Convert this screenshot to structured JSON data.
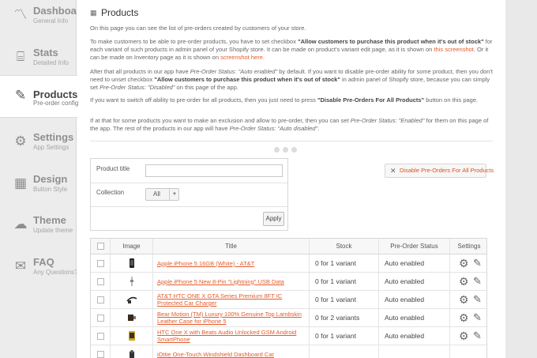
{
  "sidebar": {
    "items": [
      {
        "icon": "line-chart-icon",
        "glyph": "〽",
        "title": "Dashboard",
        "subtitle": "General Info"
      },
      {
        "icon": "presentation-icon",
        "glyph": "⌸",
        "title": "Stats",
        "subtitle": "Detailed Info"
      },
      {
        "icon": "edit-icon",
        "glyph": "✎",
        "title": "Products",
        "subtitle": "Pre-order config"
      },
      {
        "icon": "gears-icon",
        "glyph": "⚙",
        "title": "Settings",
        "subtitle": "App Settings"
      },
      {
        "icon": "layout-icon",
        "glyph": "▦",
        "title": "Design",
        "subtitle": "Button Style"
      },
      {
        "icon": "cloud-icon",
        "glyph": "☁",
        "title": "Theme",
        "subtitle": "Update theme"
      },
      {
        "icon": "chat-icon",
        "glyph": "✉",
        "title": "FAQ",
        "subtitle": "Any Questions?"
      }
    ]
  },
  "page": {
    "title": "Products",
    "intro": "On this page you can see the list of pre-orders created by customers of your store.",
    "p2_a": "To make customers to be able to pre-order products, you have to set checkbox ",
    "p2_b": "\"Allow customers to purchase this product when it's out of stock\"",
    "p2_c": " for each variant of such products in admin panel of your Shopify store. It can be made on product's variant edit page, as it is shown on ",
    "p2_link1": "this screenshot",
    "p2_d": ". Or it can be made on Inventory page as it is shown on ",
    "p2_link2": "screenshot here",
    "p2_e": ".",
    "p3_a": "After that all products in our app have ",
    "p3_b": "Pre-Order Status: \"Auto enabled\"",
    "p3_c": " by default. If you want to disable pre-order ability for some product, then you don't need to unset checkbox ",
    "p3_d": "\"Allow customers to purchase this product when it's out of stock\"",
    "p3_e": " in admin panel of Shopify store, because you can simply set ",
    "p3_f": "Pre-Order Status: \"Disabled\"",
    "p3_g": " on this page of the app.",
    "p4_a": "If you want to switch off ability to pre-order for all products, then you just need to press ",
    "p4_b": "\"Disable Pre-Orders For All Products\"",
    "p4_c": " button on this page.",
    "p5_a": "If at that for some products you want to make an exclusion and allow to pre-order, then you can set ",
    "p5_b": "Pre-Order Status: \"Enabled\"",
    "p5_c": " for them on this page of the app. The rest of the products in our app will have ",
    "p5_d": "Pre-Order Status: \"Auto disabled\"",
    "p5_e": "."
  },
  "filter": {
    "title_label": "Product title",
    "title_value": "",
    "collection_label": "Collection",
    "collection_value": "All",
    "apply_label": "Apply"
  },
  "disable_button": "Disable Pre-Orders For All Products",
  "table": {
    "headers": [
      "Image",
      "Title",
      "Stock",
      "Pre-Order Status",
      "Settings"
    ],
    "rows": [
      {
        "thumb": "phone-white",
        "title": "Apple iPhone 5 16GB (White) - AT&T",
        "stock": "0 for 1 variant",
        "status": "Auto enabled"
      },
      {
        "thumb": "cable",
        "title": "Apple iPhone 5 New 8-Pin \"Lightning\" USB Data",
        "stock": "0 for 1 variant",
        "status": "Auto enabled"
      },
      {
        "thumb": "charger",
        "title": "AT&T HTC ONE X GTA Series Premium 8FT IC Protected Car Charger",
        "stock": "0 for 1 variant",
        "status": "Auto enabled"
      },
      {
        "thumb": "case",
        "title": "Bear Motion (TM) Luxury 100% Genuine Top Lambskin Leather Case for iPhone 5",
        "stock": "0 for 2 variants",
        "status": "Auto enabled"
      },
      {
        "thumb": "case-yellow",
        "title": "HTC One X with Beats Audio Unlocked GSM Android SmartPhone",
        "stock": "0 for 1 variant",
        "status": "Auto enabled"
      },
      {
        "thumb": "mount",
        "title": "iOttie One-Touch Windshield Dashboard Car",
        "stock": "",
        "status": ""
      }
    ]
  }
}
